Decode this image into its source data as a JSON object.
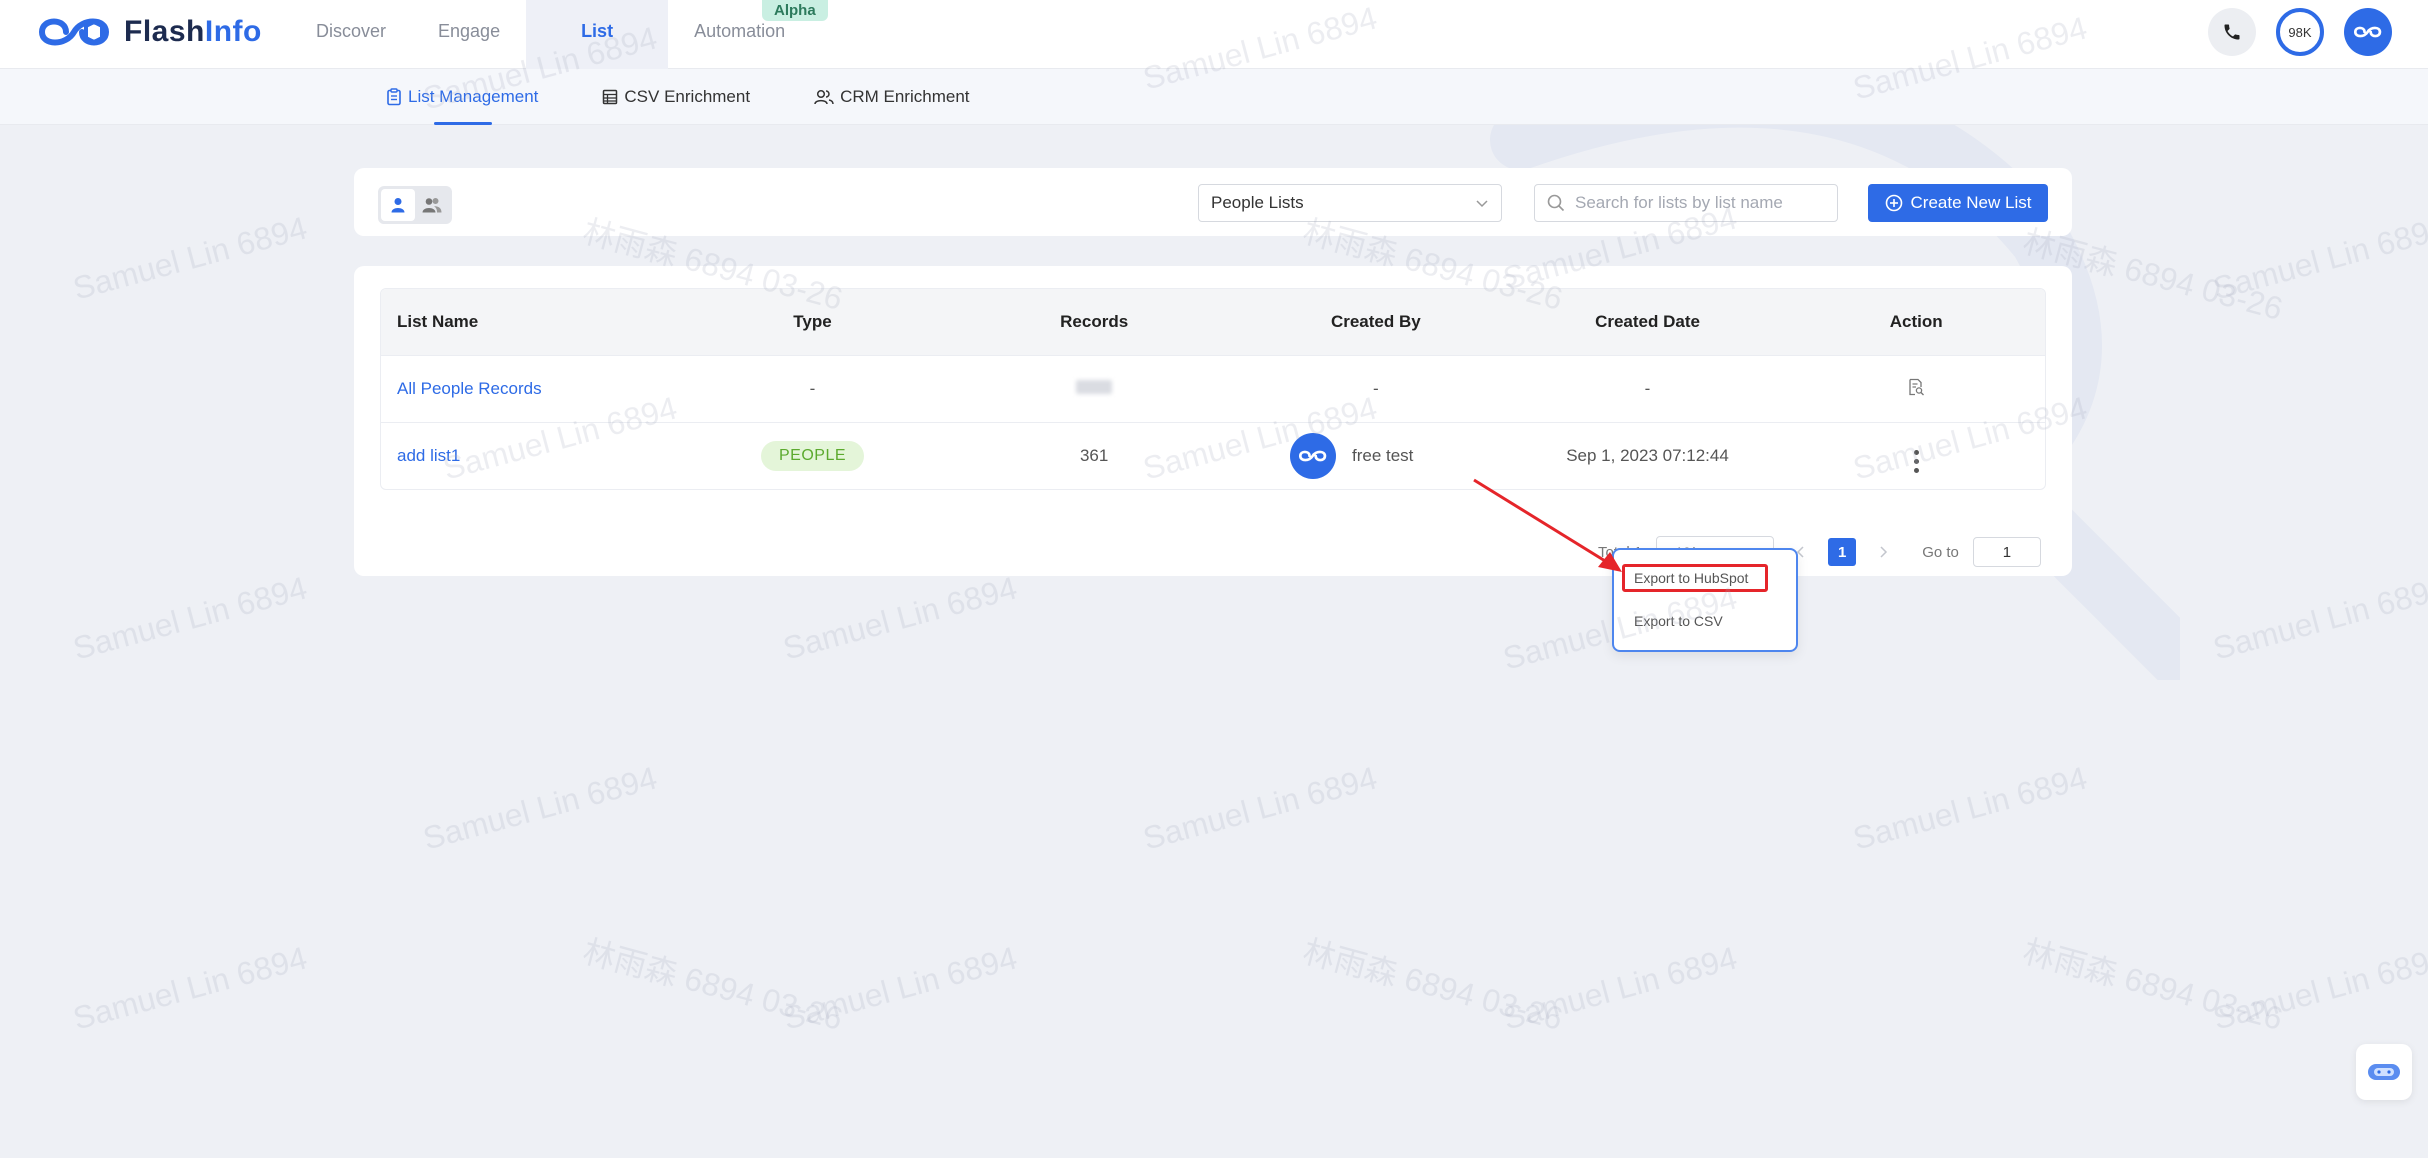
{
  "brand": {
    "name_part1": "Flash",
    "name_part2": "Info",
    "accent": "#2e6be6"
  },
  "nav": {
    "items": [
      {
        "label": "Discover"
      },
      {
        "label": "Engage"
      },
      {
        "label": "List"
      },
      {
        "label": "Automation"
      }
    ],
    "active": "List",
    "badge": "Alpha"
  },
  "header": {
    "credits": "98K",
    "phone_icon": "phone-icon",
    "avatar_icon": "flashinfo-logo-icon"
  },
  "subnav": {
    "tabs": [
      {
        "label": "List Management",
        "icon": "clipboard-icon"
      },
      {
        "label": "CSV Enrichment",
        "icon": "table-icon"
      },
      {
        "label": "CRM Enrichment",
        "icon": "users-icon"
      }
    ],
    "active": "List Management"
  },
  "toolbar": {
    "list_type_select": "People Lists",
    "search_placeholder": "Search for lists by list name",
    "create_button": "Create New List"
  },
  "table": {
    "columns": [
      "List Name",
      "Type",
      "Records",
      "Created By",
      "Created Date",
      "Action"
    ],
    "rows": [
      {
        "name": "All People Records",
        "type": "-",
        "records": "",
        "created_by": "-",
        "created_date": "-",
        "action": "view-record-icon"
      },
      {
        "name": "add list1",
        "type": "PEOPLE",
        "records": "361",
        "created_by": "free test",
        "created_date": "Sep 1, 2023 07:12:44",
        "action": "more-vertical-icon"
      }
    ]
  },
  "pagination": {
    "total": "Total 1",
    "page_size": "10/page",
    "current_page": "1",
    "goto_label": "Go to",
    "goto_value": "1"
  },
  "dropdown": {
    "items": [
      "Export to HubSpot",
      "Export to CSV"
    ],
    "highlighted": "Export to HubSpot",
    "highlight_color": "#e5252a"
  },
  "watermark": {
    "text1": "Samuel Lin 6894",
    "text2": "林雨森 6894 03-26"
  }
}
